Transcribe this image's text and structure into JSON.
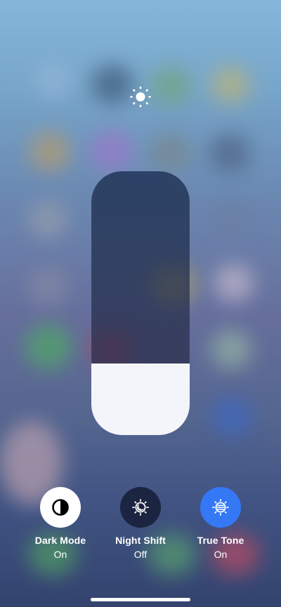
{
  "brightness": {
    "level": 0.27,
    "icon": "sun-icon"
  },
  "toggles": [
    {
      "label": "Dark Mode",
      "state": "On",
      "icon": "dark-mode-icon",
      "active": true,
      "color": "#ffffff"
    },
    {
      "label": "Night Shift",
      "state": "Off",
      "icon": "night-shift-icon",
      "active": false,
      "color": "#1b2440"
    },
    {
      "label": "True Tone",
      "state": "On",
      "icon": "true-tone-icon",
      "active": true,
      "color": "#3478f6"
    }
  ],
  "colors": {
    "slider_fill": "#f4f5fb",
    "accent": "#3478f6"
  }
}
